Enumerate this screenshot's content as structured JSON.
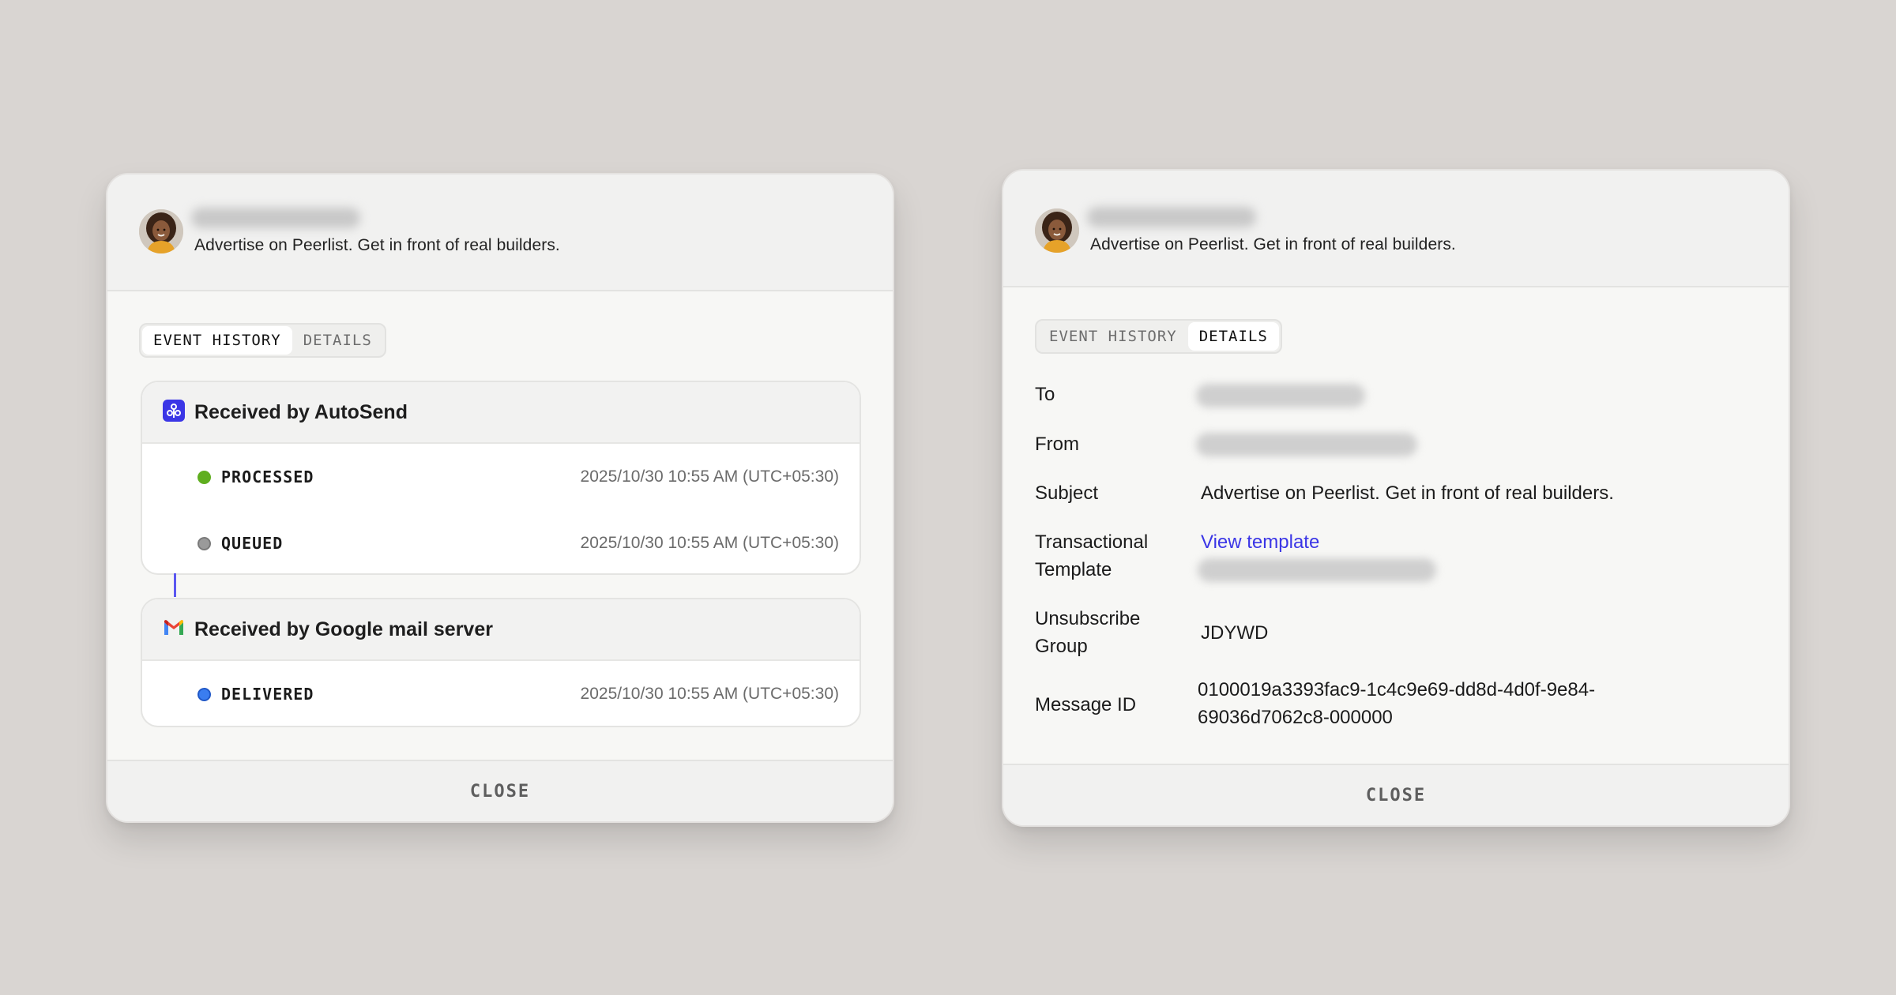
{
  "left_card": {
    "subject": "Advertise on Peerlist. Get in front of real builders.",
    "tabs": [
      "EVENT HISTORY",
      "DETAILS"
    ],
    "active_tab": "EVENT HISTORY",
    "groups": [
      {
        "title": "Received by AutoSend",
        "icon": "autosend-icon",
        "events": [
          {
            "status": "PROCESSED",
            "time": "2025/10/30 10:55 AM (UTC+05:30)",
            "color": "#5fae1f"
          },
          {
            "status": "QUEUED",
            "time": "2025/10/30 10:55 AM (UTC+05:30)",
            "color": "#9a9a9a"
          }
        ]
      },
      {
        "title": "Received by Google mail server",
        "icon": "gmail-icon",
        "events": [
          {
            "status": "DELIVERED",
            "time": "2025/10/30 10:55 AM (UTC+05:30)",
            "color": "#3a7df0"
          }
        ]
      }
    ],
    "close_label": "CLOSE"
  },
  "right_card": {
    "subject": "Advertise on Peerlist. Get in front of real builders.",
    "tabs": [
      "EVENT HISTORY",
      "DETAILS"
    ],
    "active_tab": "DETAILS",
    "details": {
      "to_label": "To",
      "from_label": "From",
      "subject_label": "Subject",
      "subject_value": "Advertise on Peerlist. Get in front of real builders.",
      "template_label_1": "Transactional",
      "template_label_2": "Template",
      "template_link": "View template",
      "unsubscribe_label_1": "Unsubscribe",
      "unsubscribe_label_2": "Group",
      "unsubscribe_value": "JDYWD",
      "message_id_label": "Message ID",
      "message_id_line1": "0100019a3393fac9-1c4c9e69-dd8d-4d0f-9e84-",
      "message_id_line2": "69036d7062c8-000000"
    },
    "close_label": "CLOSE"
  },
  "colors": {
    "accent": "#3b36e6",
    "processed": "#5fae1f",
    "queued": "#9a9a9a",
    "delivered": "#3a7df0",
    "background": "#d9d5d2"
  }
}
